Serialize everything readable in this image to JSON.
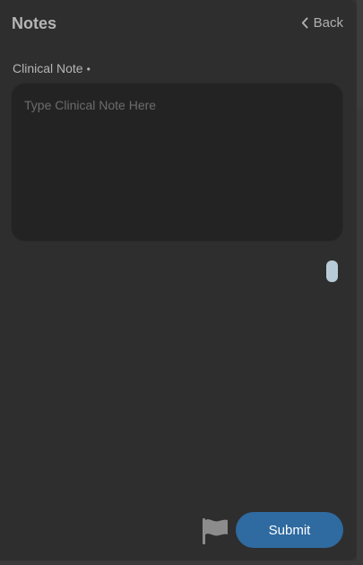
{
  "header": {
    "title": "Notes",
    "back_label": "Back"
  },
  "clinical_note": {
    "label": "Clinical Note",
    "required_marker": "•",
    "value": "",
    "placeholder": "Type Clinical Note Here"
  },
  "footer": {
    "flag_icon": "flag-icon",
    "submit_label": "Submit"
  },
  "colors": {
    "panel_bg": "#2e2e2e",
    "input_bg": "#232323",
    "submit_bg": "#2f6aa0",
    "scroll_thumb": "#b8cbd9",
    "text_muted": "#b5b5b5"
  }
}
